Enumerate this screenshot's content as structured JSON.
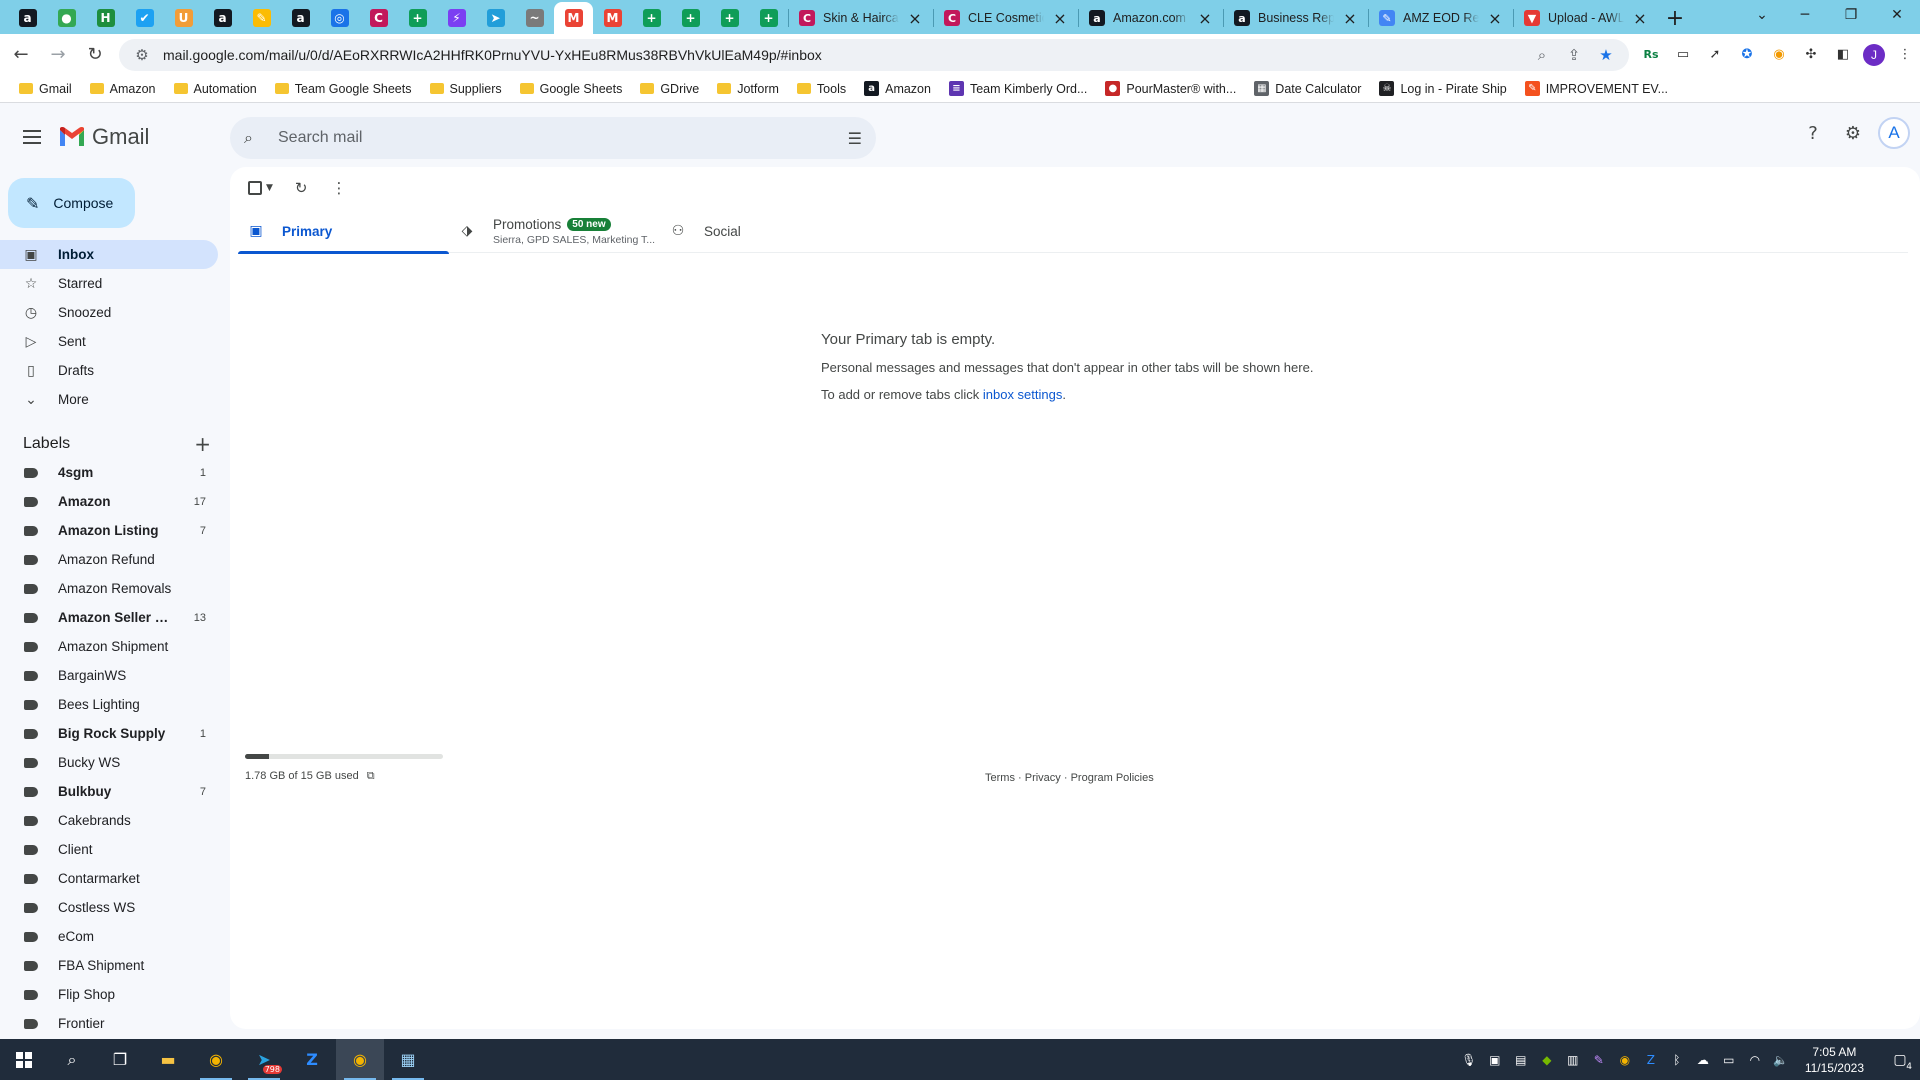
{
  "browser": {
    "pinned_tabs": [
      {
        "icon": "amazon-icon",
        "glyph": "a",
        "color": "#131921"
      },
      {
        "icon": "maps-pin-icon",
        "glyph": "●",
        "color": "#34a853"
      },
      {
        "icon": "sheets-h-icon",
        "glyph": "H",
        "color": "#1e8e3e"
      },
      {
        "icon": "bird-icon",
        "glyph": "✔",
        "color": "#1da1f2"
      },
      {
        "icon": "orange-u-icon",
        "glyph": "U",
        "color": "#f29d38"
      },
      {
        "icon": "amazon-icon",
        "glyph": "a",
        "color": "#131921"
      },
      {
        "icon": "pen-icon",
        "glyph": "✎",
        "color": "#fbbc04"
      },
      {
        "icon": "amazon-icon",
        "glyph": "a",
        "color": "#131921"
      },
      {
        "icon": "capture-icon",
        "glyph": "◎",
        "color": "#1a73e8"
      },
      {
        "icon": "cle-icon",
        "glyph": "C",
        "color": "#c2185b"
      },
      {
        "icon": "sheets-plus-icon",
        "glyph": "+",
        "color": "#0f9d58"
      },
      {
        "icon": "messenger-icon",
        "glyph": "⚡",
        "color": "#7b3ff2"
      },
      {
        "icon": "telegram-icon",
        "glyph": "➤",
        "color": "#229ed9"
      },
      {
        "icon": "signature-icon",
        "glyph": "~",
        "color": "#7a7a7a"
      },
      {
        "icon": "gmail-icon",
        "glyph": "M",
        "color": "#ea4335",
        "active": true
      },
      {
        "icon": "gmail-icon",
        "glyph": "M",
        "color": "#ea4335"
      },
      {
        "icon": "sheets-plus-icon",
        "glyph": "+",
        "color": "#0f9d58"
      },
      {
        "icon": "sheets-plus-icon",
        "glyph": "+",
        "color": "#0f9d58"
      },
      {
        "icon": "sheets-plus-icon",
        "glyph": "+",
        "color": "#0f9d58"
      },
      {
        "icon": "sheets-plus-icon",
        "glyph": "+",
        "color": "#0f9d58"
      }
    ],
    "tabs": [
      {
        "title": "Skin & Haircare",
        "icon": "cle-icon",
        "glyph": "C",
        "color": "#c2185b"
      },
      {
        "title": "CLE Cosmetics",
        "icon": "cle-icon",
        "glyph": "C",
        "color": "#c2185b"
      },
      {
        "title": "Amazon.com : ",
        "icon": "amazon-icon",
        "glyph": "a",
        "color": "#131921"
      },
      {
        "title": "Business Reports",
        "icon": "amazon-icon",
        "glyph": "a",
        "color": "#131921"
      },
      {
        "title": "AMZ EOD Report",
        "icon": "brush-icon",
        "glyph": "✎",
        "color": "#4285f4"
      },
      {
        "title": "Upload - AWL",
        "icon": "funnel-icon",
        "glyph": "▼",
        "color": "#e53935"
      }
    ],
    "url": "mail.google.com/mail/u/0/d/AEoRXRRWIcA2HHfRK0PrnuYVU-YxHEu8RMus38RBVhVkUlEaM49p/#inbox",
    "profile_initial": "J",
    "bookmarks": [
      {
        "label": "Gmail",
        "type": "folder"
      },
      {
        "label": "Amazon",
        "type": "folder"
      },
      {
        "label": "Automation",
        "type": "folder"
      },
      {
        "label": "Team Google Sheets",
        "type": "folder"
      },
      {
        "label": "Suppliers",
        "type": "folder"
      },
      {
        "label": "Google Sheets",
        "type": "folder"
      },
      {
        "label": "GDrive",
        "type": "folder"
      },
      {
        "label": "Jotform",
        "type": "folder"
      },
      {
        "label": "Tools",
        "type": "folder"
      },
      {
        "label": "Amazon",
        "type": "site",
        "glyph": "a",
        "color": "#131921"
      },
      {
        "label": "Team Kimberly Ord...",
        "type": "site",
        "glyph": "≡",
        "color": "#5e35b1"
      },
      {
        "label": "PourMaster® with...",
        "type": "site",
        "glyph": "●",
        "color": "#c62828"
      },
      {
        "label": "Date Calculator",
        "type": "site",
        "glyph": "▦",
        "color": "#5f6368"
      },
      {
        "label": "Log in - Pirate Ship",
        "type": "site",
        "glyph": "☠",
        "color": "#202124"
      },
      {
        "label": "IMPROVEMENT EV...",
        "type": "site",
        "glyph": "✎",
        "color": "#f4511e"
      }
    ]
  },
  "gmail": {
    "brand": "Gmail",
    "search_placeholder": "Search mail",
    "account_initial": "A",
    "compose_label": "Compose",
    "nav": [
      {
        "label": "Inbox",
        "icon": "inbox-icon",
        "glyph": "▣",
        "active": true
      },
      {
        "label": "Starred",
        "icon": "star-icon",
        "glyph": "☆"
      },
      {
        "label": "Snoozed",
        "icon": "clock-icon",
        "glyph": "◷"
      },
      {
        "label": "Sent",
        "icon": "send-icon",
        "glyph": "▷"
      },
      {
        "label": "Drafts",
        "icon": "draft-icon",
        "glyph": "▯"
      },
      {
        "label": "More",
        "icon": "chevron-down-icon",
        "glyph": "⌄"
      }
    ],
    "labels_heading": "Labels",
    "labels": [
      {
        "name": "4sgm",
        "count": "1",
        "bold": true
      },
      {
        "name": "Amazon",
        "count": "17",
        "bold": true
      },
      {
        "name": "Amazon Listing",
        "count": "7",
        "bold": true
      },
      {
        "name": "Amazon Refund",
        "count": "",
        "bold": false
      },
      {
        "name": "Amazon Removals",
        "count": "",
        "bold": false
      },
      {
        "name": "Amazon Seller Ce...",
        "count": "13",
        "bold": true
      },
      {
        "name": "Amazon Shipment",
        "count": "",
        "bold": false
      },
      {
        "name": "BargainWS",
        "count": "",
        "bold": false
      },
      {
        "name": "Bees Lighting",
        "count": "",
        "bold": false
      },
      {
        "name": "Big Rock Supply",
        "count": "1",
        "bold": true
      },
      {
        "name": "Bucky WS",
        "count": "",
        "bold": false
      },
      {
        "name": "Bulkbuy",
        "count": "7",
        "bold": true
      },
      {
        "name": "Cakebrands",
        "count": "",
        "bold": false
      },
      {
        "name": "Client",
        "count": "",
        "bold": false
      },
      {
        "name": "Contarmarket",
        "count": "",
        "bold": false
      },
      {
        "name": "Costless WS",
        "count": "",
        "bold": false
      },
      {
        "name": "eCom",
        "count": "",
        "bold": false
      },
      {
        "name": "FBA Shipment",
        "count": "",
        "bold": false
      },
      {
        "name": "Flip Shop",
        "count": "",
        "bold": false
      },
      {
        "name": "Frontier",
        "count": "",
        "bold": false
      }
    ],
    "category_tabs": {
      "primary": "Primary",
      "promotions": "Promotions",
      "promotions_badge": "50 new",
      "promotions_sub": "Sierra, GPD SALES, Marketing T...",
      "social": "Social"
    },
    "empty": {
      "title": "Your Primary tab is empty.",
      "line1": "Personal messages and messages that don't appear in other tabs will be shown here.",
      "line2_prefix": "To add or remove tabs click ",
      "line2_link": "inbox settings",
      "line2_suffix": "."
    },
    "storage": {
      "text": "1.78 GB of 15 GB used",
      "fraction": 0.119
    },
    "footer": {
      "terms": "Terms",
      "sep": " · ",
      "privacy": "Privacy",
      "policies": "Program Policies"
    }
  },
  "taskbar": {
    "time": "7:05 AM",
    "date": "11/15/2023",
    "notification_count": "4",
    "telegram_badge": "798"
  }
}
